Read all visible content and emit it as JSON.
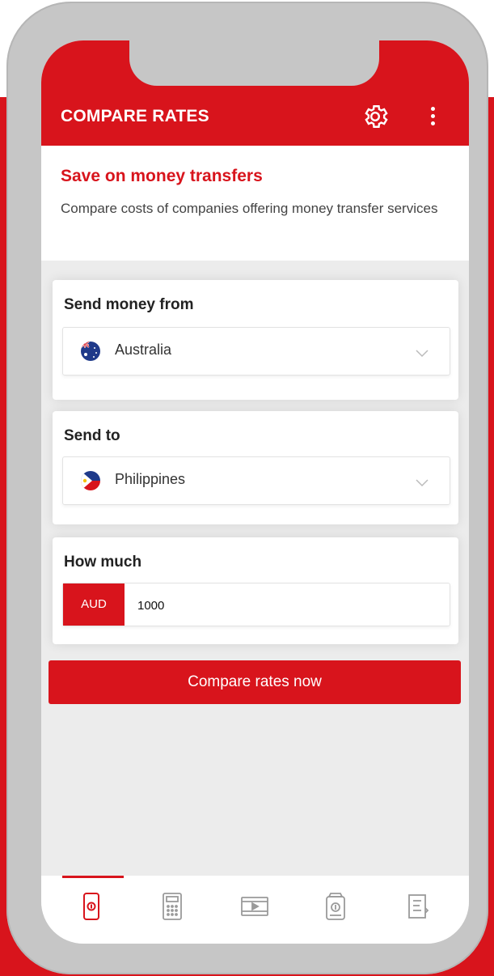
{
  "app_bar": {
    "title": "COMPARE RATES",
    "settings_icon": "gear-icon",
    "menu_icon": "more-vertical-icon"
  },
  "intro": {
    "title": "Save on money transfers",
    "description": "Compare costs of companies offering money transfer services"
  },
  "send_from": {
    "label": "Send money from",
    "value": "Australia",
    "flag_icon": "australia-flag-icon"
  },
  "send_to": {
    "label": "Send to",
    "value": "Philippines",
    "flag_icon": "philippines-flag-icon"
  },
  "amount": {
    "label": "How much",
    "currency": "AUD",
    "value": "1000"
  },
  "compare_button": "Compare rates now",
  "bottom_nav": {
    "items": [
      {
        "icon": "phone-money-icon",
        "active": true
      },
      {
        "icon": "calculator-icon",
        "active": false
      },
      {
        "icon": "video-icon",
        "active": false
      },
      {
        "icon": "wallet-icon",
        "active": false
      },
      {
        "icon": "document-icon",
        "active": false
      }
    ]
  },
  "colors": {
    "accent": "#d8141c",
    "background": "#ececec",
    "text": "#222222"
  }
}
